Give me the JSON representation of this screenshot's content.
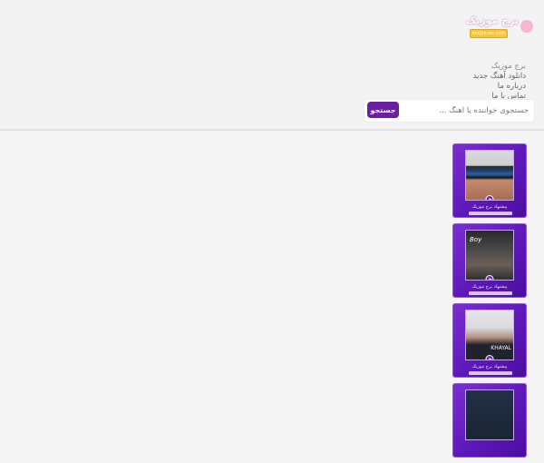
{
  "brand": {
    "title": "برج موزیک",
    "url": "borjmusic.com"
  },
  "nav": {
    "items": [
      {
        "label": "برج موزیک"
      },
      {
        "label": "دانلود آهنگ جدید"
      },
      {
        "label": "درباره ما"
      },
      {
        "label": "تماس با ما"
      }
    ]
  },
  "search": {
    "placeholder": "جستجوی خواننده یا آهنگ ...",
    "button_label": "جستجو"
  },
  "sidebar": {
    "cards": [
      {
        "caption": "پیشنهاد برج موزیک",
        "cover_text": ""
      },
      {
        "caption": "پیشنهاد برج موزیک",
        "cover_text": "Boy"
      },
      {
        "caption": "پیشنهاد برج موزیک",
        "cover_text": "KHAYAL"
      },
      {
        "caption": "",
        "cover_text": ""
      }
    ]
  },
  "colors": {
    "accent": "#6a1fa3",
    "card": "#5b16b8"
  }
}
